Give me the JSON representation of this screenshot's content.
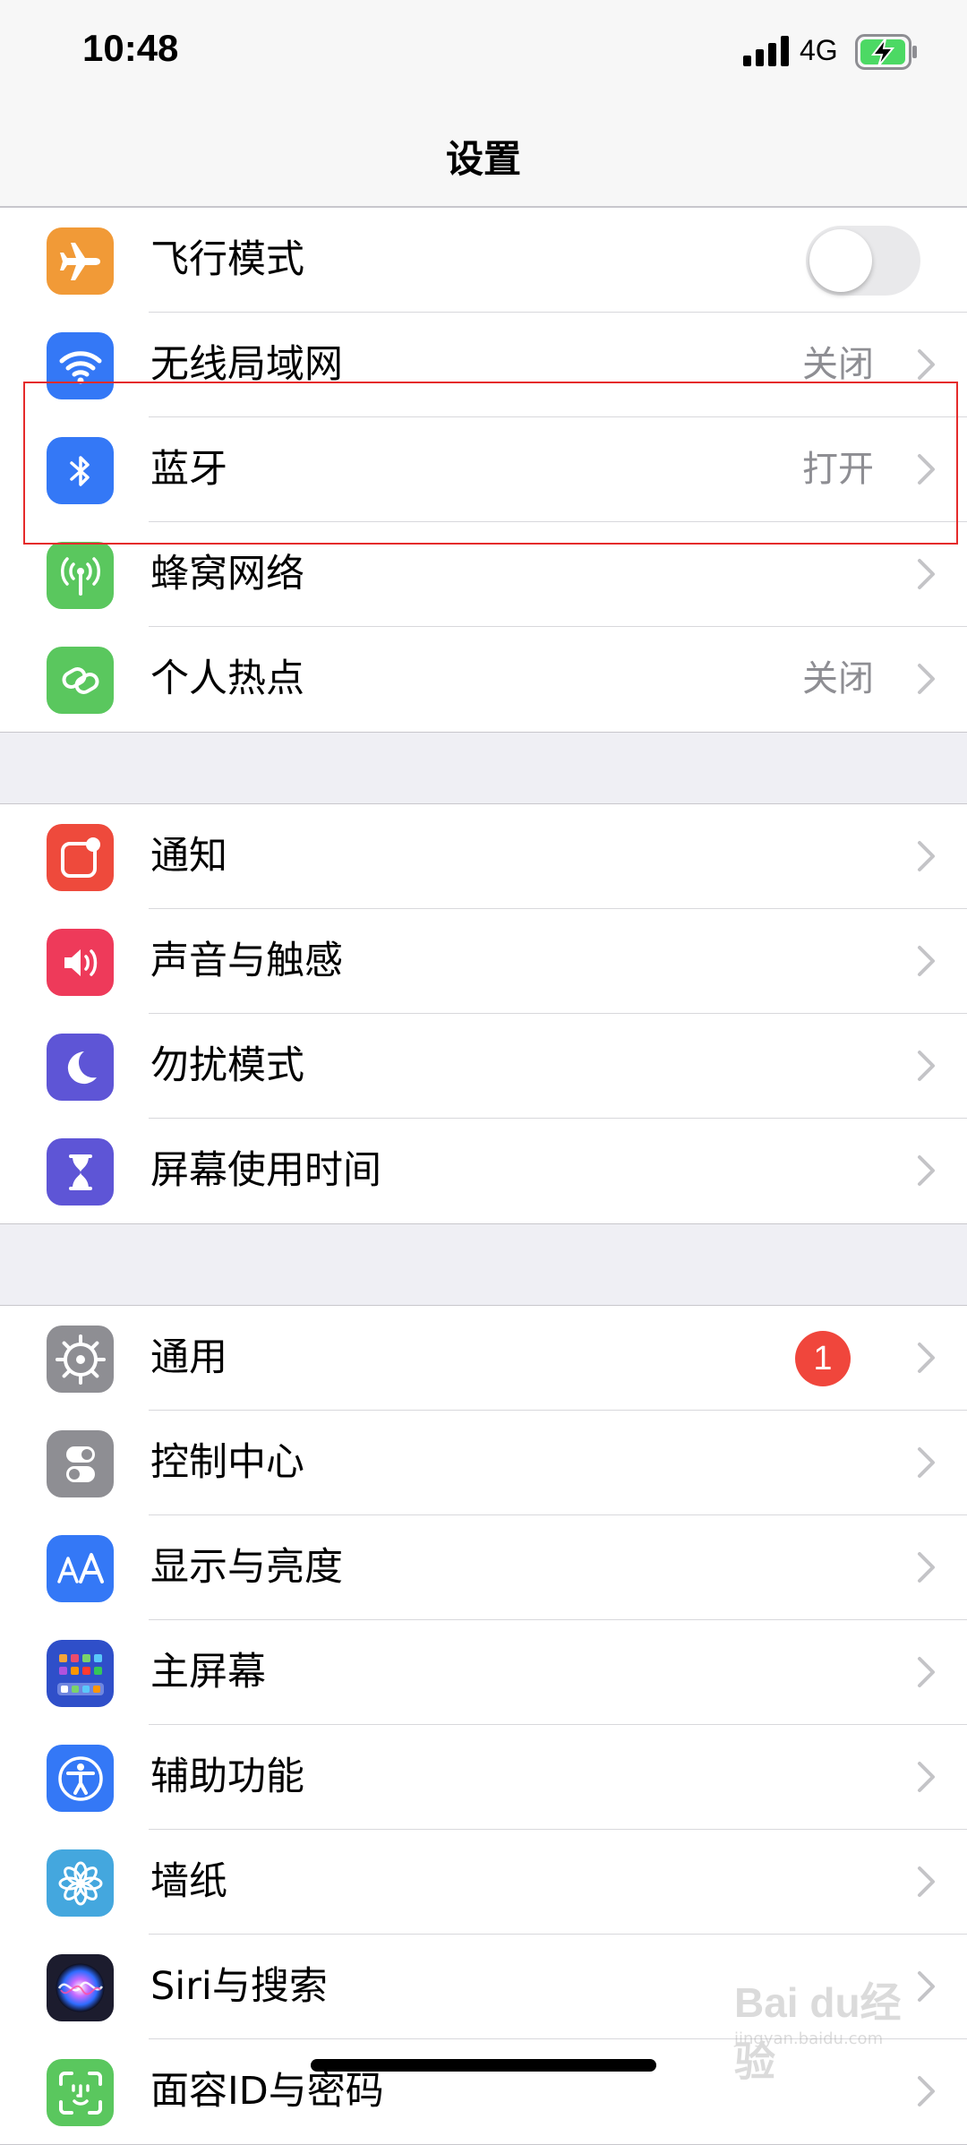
{
  "status_bar": {
    "time": "10:48",
    "network": "4G"
  },
  "nav": {
    "title": "设置"
  },
  "groups": [
    [
      {
        "id": "airplane",
        "label": "飞行模式",
        "icon": "airplane-icon",
        "color": "#f19a37",
        "control": "toggle",
        "toggle_on": false
      },
      {
        "id": "wifi",
        "label": "无线局域网",
        "value": "关闭",
        "icon": "wifi-icon",
        "color": "#3478f6"
      },
      {
        "id": "bluetooth",
        "label": "蓝牙",
        "value": "打开",
        "icon": "bluetooth-icon",
        "color": "#3478f6"
      },
      {
        "id": "cellular",
        "label": "蜂窝网络",
        "icon": "cellular-antenna-icon",
        "color": "#5ac75e"
      },
      {
        "id": "hotspot",
        "label": "个人热点",
        "value": "关闭",
        "icon": "hotspot-link-icon",
        "color": "#5ac75e"
      }
    ],
    [
      {
        "id": "notifications",
        "label": "通知",
        "icon": "notifications-icon",
        "color": "#ee4a3c"
      },
      {
        "id": "sounds",
        "label": "声音与触感",
        "icon": "speaker-icon",
        "color": "#ee3a5a"
      },
      {
        "id": "dnd",
        "label": "勿扰模式",
        "icon": "moon-icon",
        "color": "#5e55d6"
      },
      {
        "id": "screentime",
        "label": "屏幕使用时间",
        "icon": "hourglass-icon",
        "color": "#5e55d6"
      }
    ],
    [
      {
        "id": "general",
        "label": "通用",
        "badge": "1",
        "icon": "gear-icon",
        "color": "#8e8e93"
      },
      {
        "id": "control-center",
        "label": "控制中心",
        "icon": "toggles-icon",
        "color": "#8e8e93"
      },
      {
        "id": "display",
        "label": "显示与亮度",
        "icon": "text-size-icon",
        "color": "#3478f6"
      },
      {
        "id": "home-screen",
        "label": "主屏幕",
        "icon": "home-screen-grid-icon",
        "color": "#2f4fc9"
      },
      {
        "id": "accessibility",
        "label": "辅助功能",
        "icon": "accessibility-icon",
        "color": "#3478f6"
      },
      {
        "id": "wallpaper",
        "label": "墙纸",
        "icon": "flower-icon",
        "color": "#44a7de"
      },
      {
        "id": "siri",
        "label": "Siri与搜索",
        "icon": "siri-icon",
        "color": "#1c1c2e"
      },
      {
        "id": "faceid",
        "label": "面容ID与密码",
        "icon": "face-id-icon",
        "color": "#5ac75e"
      }
    ]
  ],
  "watermark": {
    "text": "Bai du经验",
    "sub": "jingyan.baidu.com"
  },
  "colors": {
    "highlight_box": "#e52b2b",
    "badge": "#f0463c",
    "group_background": "#efeff4"
  }
}
